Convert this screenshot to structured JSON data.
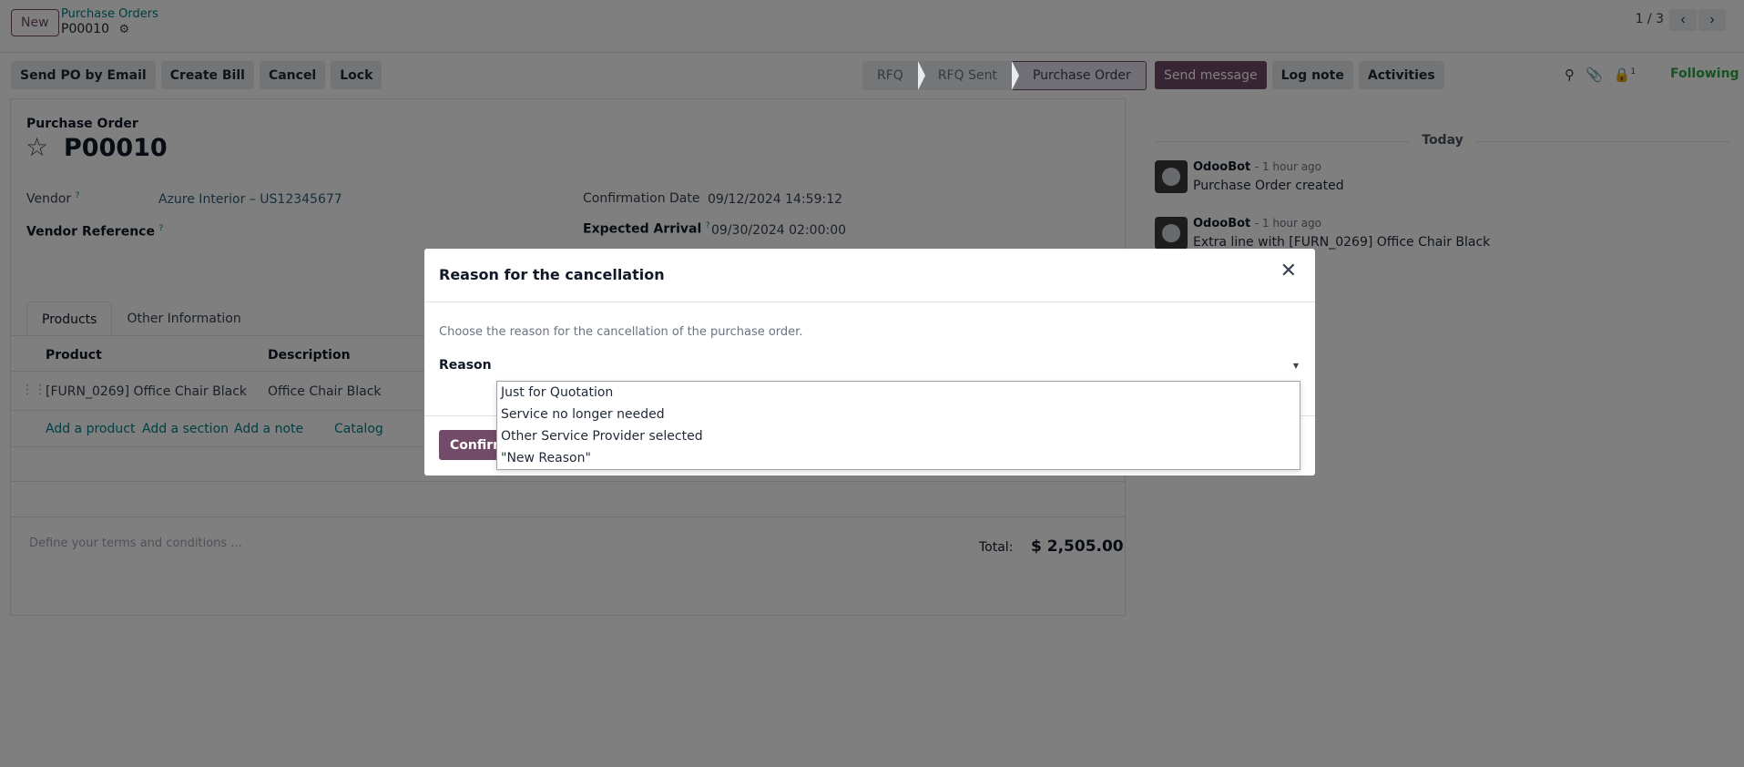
{
  "header": {
    "new_label": "New",
    "breadcrumb_parent": "Purchase Orders",
    "breadcrumb_current": "P00010",
    "pager": "1 / 3"
  },
  "actions": {
    "send_po_email": "Send PO by Email",
    "create_bill": "Create Bill",
    "cancel": "Cancel",
    "lock": "Lock"
  },
  "status": {
    "stages": [
      "RFQ",
      "RFQ Sent",
      "Purchase Order"
    ],
    "active": "Purchase Order"
  },
  "form": {
    "subtitle": "Purchase Order",
    "name": "P00010",
    "vendor_label": "Vendor",
    "vendor_value": "Azure Interior – US12345677",
    "vendor_ref_label": "Vendor Reference",
    "confirmation_label": "Confirmation Date",
    "confirmation_value": "09/12/2024 14:59:12",
    "arrival_label": "Expected Arrival",
    "arrival_value": "09/30/2024 02:00:00",
    "help_mark": "?",
    "tabs": [
      "Products",
      "Other Information"
    ],
    "columns": [
      "Product",
      "Description"
    ],
    "line": {
      "product": "[FURN_0269] Office Chair Black",
      "description": "Office Chair Black"
    },
    "add_links": [
      "Add a product",
      "Add a section",
      "Add a note",
      "Catalog"
    ],
    "terms_placeholder": "Define your terms and conditions ...",
    "total_label": "Total:",
    "total_value": "$ 2,505.00"
  },
  "chatter": {
    "send_message": "Send message",
    "log_note": "Log note",
    "activities": "Activities",
    "followers_count": "1",
    "following": "Following",
    "today": "Today",
    "messages": [
      {
        "author": "OdooBot",
        "time": "- 1 hour ago",
        "body": "Purchase Order created"
      },
      {
        "author": "OdooBot",
        "time": "- 1 hour ago",
        "body": "Extra line with [FURN_0269] Office Chair Black"
      }
    ]
  },
  "modal": {
    "title": "Reason for the cancellation",
    "description": "Choose the reason for the cancellation of the purchase order.",
    "reason_label": "Reason",
    "confirm": "Confirm",
    "options": [
      "Just for Quotation",
      "Service no longer needed",
      "Other Service Provider selected",
      "\"New Reason\""
    ]
  },
  "icons": {
    "gear": "gear-icon",
    "star": "star-icon",
    "close": "close-icon",
    "search": "search-icon",
    "paperclip": "paperclip-icon",
    "followers": "lock-user-icon"
  }
}
